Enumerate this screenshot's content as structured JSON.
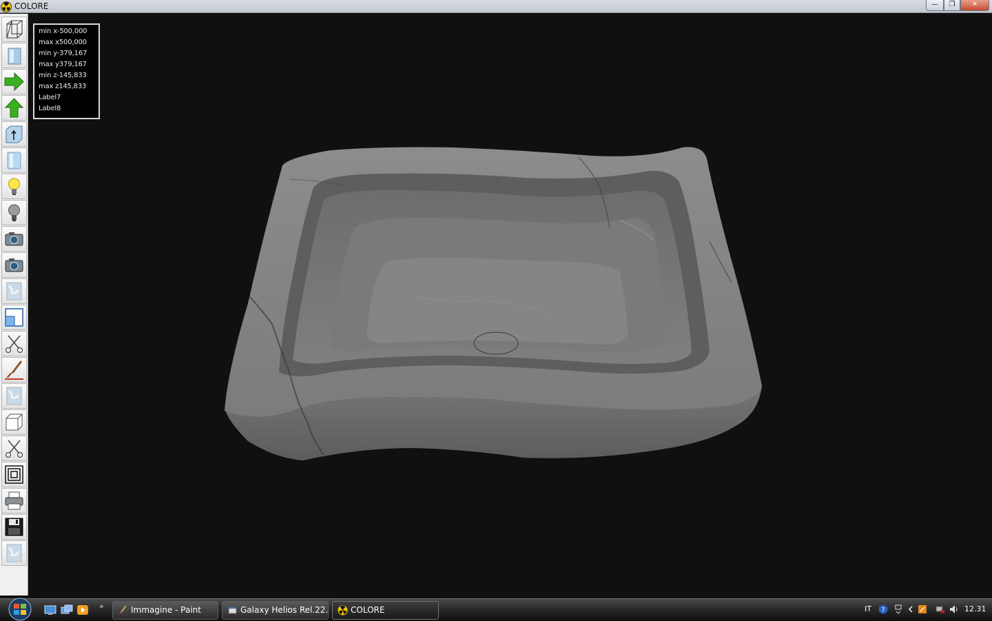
{
  "window": {
    "title": "COLORE"
  },
  "toolbar": {
    "tools": [
      {
        "name": "wireframe-view-icon"
      },
      {
        "name": "solid-view-icon"
      },
      {
        "name": "arrow-right-icon"
      },
      {
        "name": "arrow-up-icon"
      },
      {
        "name": "extrude-icon"
      },
      {
        "name": "cylinder-icon"
      },
      {
        "name": "light-on-icon"
      },
      {
        "name": "light-off-icon"
      },
      {
        "name": "camera-icon"
      },
      {
        "name": "camera-2-icon"
      },
      {
        "name": "texture-icon"
      },
      {
        "name": "window-resize-icon"
      },
      {
        "name": "scissors-icon"
      },
      {
        "name": "brush-icon"
      },
      {
        "name": "texture-2-icon"
      },
      {
        "name": "cube-icon"
      },
      {
        "name": "scissors-2-icon"
      },
      {
        "name": "concentric-squares-icon"
      },
      {
        "name": "printer-icon"
      },
      {
        "name": "save-disk-icon"
      },
      {
        "name": "texture-3-icon"
      }
    ]
  },
  "info": {
    "min_x": "min x-500,000",
    "max_x": "max x500,000",
    "min_y": "min y-379,167",
    "max_y": "max y379,167",
    "min_z": "min z-145,833",
    "max_z": "max z145,833",
    "label7": "Label7",
    "label8": "Label8"
  },
  "taskbar": {
    "tasks": [
      {
        "label": "Immagine - Paint",
        "icon": "paint-icon"
      },
      {
        "label": "Galaxy Helios  Rel.22...",
        "icon": "helios-icon"
      },
      {
        "label": "COLORE",
        "icon": "colore-icon"
      }
    ],
    "tray": {
      "language": "IT",
      "clock": "12.31"
    }
  },
  "colors": {
    "viewport_bg": "#101010",
    "marble": "#8a8a8a"
  }
}
